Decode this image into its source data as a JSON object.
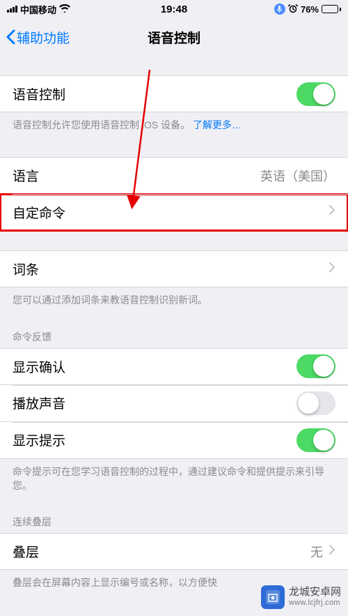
{
  "status": {
    "carrier": "中国移动",
    "time": "19:48",
    "battery_pct": "76%"
  },
  "nav": {
    "back_label": "辅助功能",
    "title": "语音控制"
  },
  "group1": {
    "voice_control_label": "语音控制",
    "footer_text": "语音控制允许您使用语音控制 iOS 设备。",
    "learn_more": "了解更多…"
  },
  "group2": {
    "language_label": "语言",
    "language_value": "英语（美国）",
    "custom_commands_label": "自定命令"
  },
  "group3": {
    "vocabulary_label": "词条",
    "footer": "您可以通过添加词条来教语音控制识别新词。"
  },
  "group4": {
    "header": "命令反馈",
    "show_confirm": "显示确认",
    "play_sound": "播放声音",
    "show_hints": "显示提示",
    "footer": "命令提示可在您学习语音控制的过程中，通过建议命令和提供提示来引导您。"
  },
  "group5": {
    "header": "连续叠层",
    "overlay_label": "叠层",
    "overlay_value": "无",
    "footer": "叠层会在屏幕内容上显示编号或名称，以方便快"
  },
  "watermark": {
    "line1": "龙城安卓网",
    "line2": "www.lcjfrj.com"
  }
}
